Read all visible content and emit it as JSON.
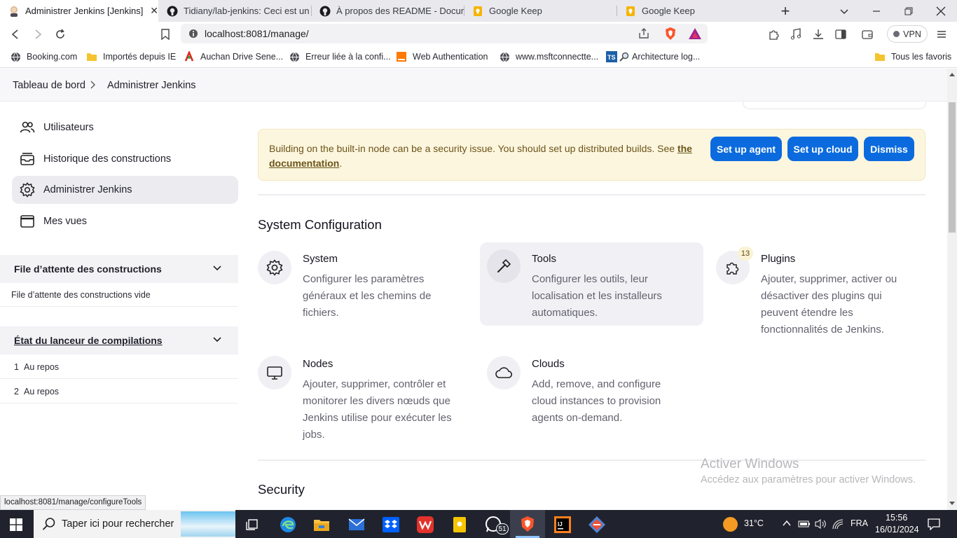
{
  "browser": {
    "tabs": [
      {
        "title": "Administrer Jenkins [Jenkins]",
        "active": true
      },
      {
        "title": "Tidiany/lab-jenkins: Ceci est un pr",
        "active": false
      },
      {
        "title": "À propos des README - Documen",
        "active": false
      },
      {
        "title": "Google Keep",
        "active": false
      },
      {
        "title": "Google Keep",
        "active": false
      }
    ],
    "url": "localhost:8081/manage/",
    "vpn_label": "VPN",
    "bookmarks": [
      "Booking.com",
      "Importés depuis IE",
      "Auchan Drive Sene...",
      "Erreur liée à la confi...",
      "Web Authentication",
      "www.msftconnectte...",
      "Architecture log..."
    ],
    "all_bookmarks": "Tous les favoris"
  },
  "breadcrumb": {
    "items": [
      "Tableau de bord",
      "Administrer Jenkins"
    ],
    "separator": ">"
  },
  "sidebar": {
    "items": [
      {
        "label": "Utilisateurs",
        "icon": "users-icon"
      },
      {
        "label": "Historique des constructions",
        "icon": "history-icon"
      },
      {
        "label": "Administrer Jenkins",
        "icon": "gear-icon",
        "active": true
      },
      {
        "label": "Mes vues",
        "icon": "window-icon"
      }
    ],
    "queue": {
      "title": "File d’attente des constructions",
      "empty": "File d’attente des constructions vide"
    },
    "executors": {
      "title": "État du lanceur de compilations",
      "rows": [
        {
          "num": "1",
          "status": "Au repos"
        },
        {
          "num": "2",
          "status": "Au repos"
        }
      ]
    }
  },
  "alert": {
    "text": "Building on the built-in node can be a security issue. You should set up distributed builds. See ",
    "link": "the documentation",
    "period": ".",
    "buttons": {
      "agent": "Set up agent",
      "cloud": "Set up cloud",
      "dismiss": "Dismiss"
    }
  },
  "sections": {
    "system_configuration": "System Configuration",
    "security": "Security"
  },
  "cards": [
    {
      "title": "System",
      "description": "Configurer les paramètres généraux et les chemins de fichiers.",
      "icon": "gear-icon"
    },
    {
      "title": "Tools",
      "description": "Configurer les outils, leur localisation et les installeurs automatiques.",
      "icon": "hammer-icon"
    },
    {
      "title": "Plugins",
      "description": "Ajouter, supprimer, activer ou désactiver des plugins qui peuvent étendre les fonctionnalités de Jenkins.",
      "icon": "puzzle-icon",
      "badge": "13"
    },
    {
      "title": "Nodes",
      "description": "Ajouter, supprimer, contrôler et monitorer les divers nœuds que Jenkins utilise pour exécuter les jobs.",
      "icon": "monitor-icon"
    },
    {
      "title": "Clouds",
      "description": "Add, remove, and configure cloud instances to provision agents on-demand.",
      "icon": "cloud-icon"
    }
  ],
  "status_bar_url": "localhost:8081/manage/configureTools",
  "watermark": {
    "title": "Activer Windows",
    "subtitle": "Accédez aux paramètres pour activer Windows."
  },
  "taskbar": {
    "search_placeholder": "Taper ici pour rechercher",
    "whatsapp_badge": "51",
    "weather": "31°C",
    "language": "FRA",
    "time": "15:56",
    "date": "16/01/2024"
  },
  "colors": {
    "accent": "#0b6bde",
    "alert_bg": "#fdf6df",
    "alert_text": "#6b5418",
    "taskbar": "#20232d"
  }
}
